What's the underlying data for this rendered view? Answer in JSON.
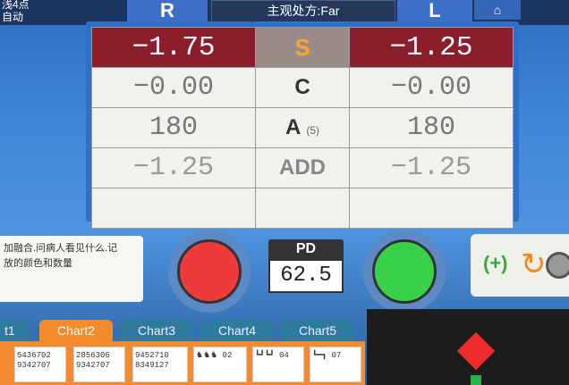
{
  "topbar": {
    "status_line1": "浅4点",
    "status_line2": "自动",
    "right_eye": "R",
    "prescription": "主观处方:Far",
    "left_eye": "L",
    "home_icon": "home-icon"
  },
  "refraction": {
    "right": {
      "S": "−1.75",
      "C": "−0.00",
      "A": "180",
      "ADD": "−1.25"
    },
    "left": {
      "S": "−1.25",
      "C": "−0.00",
      "A": "180",
      "ADD": "−1.25"
    },
    "labels": {
      "S": "S",
      "C": "C",
      "A": "A",
      "A_sub": "(5)",
      "ADD": "ADD"
    }
  },
  "info": {
    "line1": "加融合.问病人看见什么.记",
    "line2": "放的颜色和数量"
  },
  "pd": {
    "label": "PD",
    "value": "62.5"
  },
  "adjust": {
    "plus": "(+)"
  },
  "tabs": [
    "t1",
    "Chart2",
    "Chart3",
    "Chart4",
    "Chart5"
  ],
  "charts": [
    "5436702\n9342707",
    "2856306\n9342707",
    "9452710\n8349127",
    "♞♞♞ 02",
    "┗┛┗┛ 04",
    "┗━┓ 07"
  ],
  "colors": {
    "red_button": "#ee3a3a",
    "green_button": "#3ad14a",
    "header_red": "#8a1f2b",
    "active_tab": "#f38a2c"
  }
}
